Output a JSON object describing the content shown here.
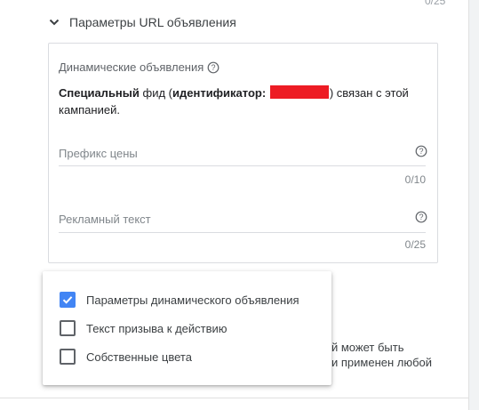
{
  "top_counter": "0/25",
  "section": {
    "title": "Параметры URL объявления",
    "chevron_icon": "chevron-down-icon"
  },
  "card": {
    "dynamic_label": "Динамические объявления",
    "feed": {
      "bold1": "Специальный",
      "text1": " фид (",
      "bold2": "идентификатор:",
      "text2": ") связан с этой кампанией."
    },
    "fields": [
      {
        "label": "Префикс цены",
        "counter": "0/10"
      },
      {
        "label": "Рекламный текст",
        "counter": "0/25"
      }
    ]
  },
  "behind_text": {
    "line1": "й может быть",
    "line2": "и применен любой"
  },
  "menu": {
    "items": [
      {
        "label": "Параметры динамического объявления",
        "checked": true
      },
      {
        "label": "Текст призыва к действию",
        "checked": false
      },
      {
        "label": "Собственные цвета",
        "checked": false
      }
    ]
  },
  "colors": {
    "accent": "#4285f4",
    "redaction": "#ed1c24"
  }
}
